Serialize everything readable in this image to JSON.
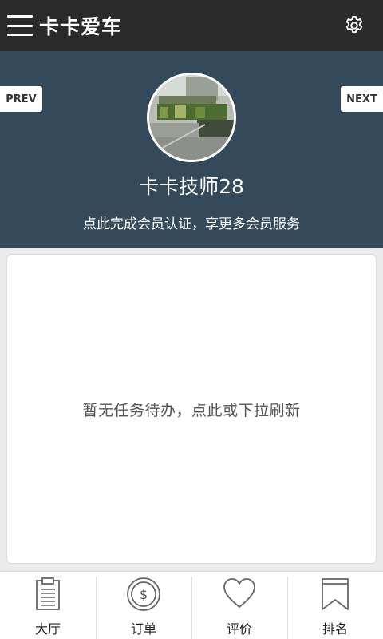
{
  "header": {
    "title": "卡卡爱车",
    "menu_icon": "menu-icon",
    "settings_icon": "gear-icon"
  },
  "profile": {
    "prev_label": "PREV",
    "next_label": "NEXT",
    "name": "卡卡技师28",
    "member_prompt": "点此完成会员认证，享更多会员服务"
  },
  "tasks": {
    "empty_message": "暂无任务待办，点此或下拉刷新"
  },
  "tabbar": {
    "items": [
      {
        "label": "大厅",
        "icon": "clipboard-icon"
      },
      {
        "label": "订单",
        "icon": "dollar-coin-icon"
      },
      {
        "label": "评价",
        "icon": "heart-icon"
      },
      {
        "label": "排名",
        "icon": "bookmark-icon"
      }
    ]
  },
  "colors": {
    "topbar": "#2a2a2a",
    "profile_bg": "#34495a",
    "page_bg": "#ebebeb"
  }
}
